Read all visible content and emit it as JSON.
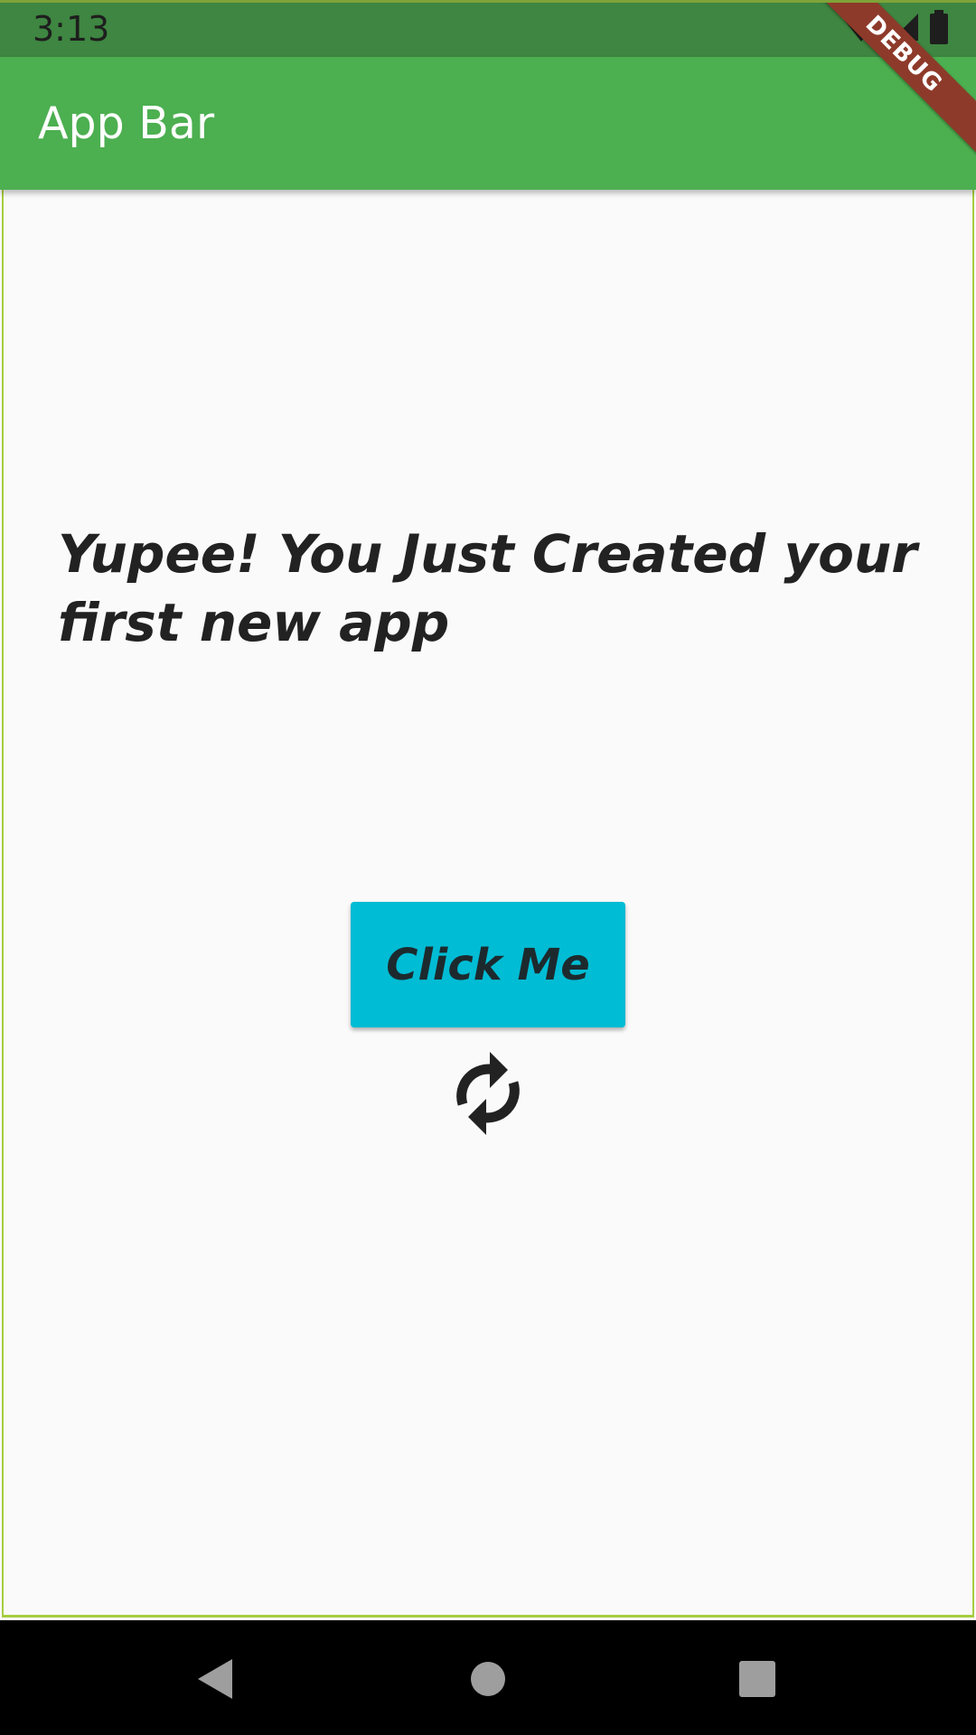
{
  "status_bar": {
    "time": "3:13",
    "icons": [
      "wifi-off-icon",
      "signal-icon",
      "battery-icon"
    ]
  },
  "app_bar": {
    "title": "App Bar",
    "color": "#4caf50"
  },
  "debug_banner": {
    "label": "DEBUG"
  },
  "main": {
    "headline": "Yupee! You Just Created your first new app",
    "button_label": "Click Me",
    "button_color": "#00bcd4",
    "icon": "sync-icon"
  },
  "nav_bar": {
    "buttons": [
      "back-icon",
      "home-icon",
      "recents-icon"
    ]
  }
}
